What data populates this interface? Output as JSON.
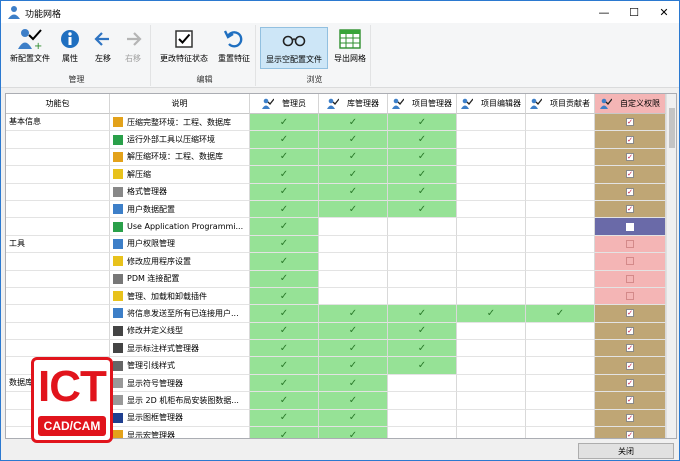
{
  "window": {
    "title": "功能网格",
    "minimize": "—",
    "maximize": "☐",
    "close": "✕"
  },
  "ribbon": {
    "groups": {
      "manage": "管理",
      "edit": "编辑",
      "browse": "浏览"
    },
    "buttons": {
      "new_config": "新配置文件",
      "properties": "属性",
      "move_left": "左移",
      "move_right": "右移",
      "change_feature_state": "更改特征状态",
      "reset_feature": "重置特征",
      "show_empty_config": "显示空配置文件",
      "export_grid": "导出网格"
    }
  },
  "grid": {
    "columns": {
      "package": "功能包",
      "description": "说明",
      "roles": [
        "管理员",
        "库管理器",
        "项目管理器",
        "项目编辑器",
        "项目贡献者",
        "自定义权限"
      ]
    },
    "rows": [
      {
        "pkg": "基本信息",
        "desc": "压缩完整环境：工程、数据库",
        "roles": "GGG.....",
        "c": "y"
      },
      {
        "pkg": "",
        "desc": "运行外部工具以压缩环境",
        "roles": "GGG",
        "c": "y"
      },
      {
        "pkg": "",
        "desc": "解压缩环境：工程、数据库",
        "roles": "GGG",
        "c": "y"
      },
      {
        "pkg": "",
        "desc": "解压缩",
        "roles": "GGG",
        "c": "y"
      },
      {
        "pkg": "",
        "desc": "格式管理器",
        "roles": "GGG",
        "c": "y"
      },
      {
        "pkg": "",
        "desc": "用户数据配置",
        "roles": "GGG",
        "c": "y"
      },
      {
        "pkg": "",
        "desc": "Use Application Programmi...",
        "roles": "G",
        "c": "s"
      },
      {
        "pkg": "工具",
        "desc": "用户权限管理",
        "roles": "G",
        "c": "n"
      },
      {
        "pkg": "",
        "desc": "修改应用程序设置",
        "roles": "G",
        "c": "n"
      },
      {
        "pkg": "",
        "desc": "PDM 连接配置",
        "roles": "G",
        "c": "n"
      },
      {
        "pkg": "",
        "desc": "管理、加载和卸载插件",
        "roles": "G",
        "c": "n"
      },
      {
        "pkg": "",
        "desc": "将信息发送至所有已连接用户...",
        "roles": "GGGGG",
        "c": "y"
      },
      {
        "pkg": "",
        "desc": "修改并定义线型",
        "roles": "GGG",
        "c": "y"
      },
      {
        "pkg": "",
        "desc": "显示标注样式管理器",
        "roles": "GGG",
        "c": "y"
      },
      {
        "pkg": "",
        "desc": "管理引线样式",
        "roles": "GGG",
        "c": "y"
      },
      {
        "pkg": "数据库",
        "desc": "显示符号管理器",
        "roles": "GG",
        "c": "y"
      },
      {
        "pkg": "",
        "desc": "显示 2D 机柜布局安装图数据...",
        "roles": "GG",
        "c": "y"
      },
      {
        "pkg": "",
        "desc": "显示图框管理器",
        "roles": "GG",
        "c": "y"
      },
      {
        "pkg": "",
        "desc": "显示宏管理器",
        "roles": "GG",
        "c": "y"
      }
    ]
  },
  "logo": {
    "line1": "ICT",
    "line2": "CAD/CAM"
  },
  "footer": {
    "close": "关闭"
  },
  "colors": {
    "allowed": "#96e296",
    "custom_on": "#bfa675",
    "custom_off": "#f4b5b5",
    "selected": "#6a6aa8"
  }
}
